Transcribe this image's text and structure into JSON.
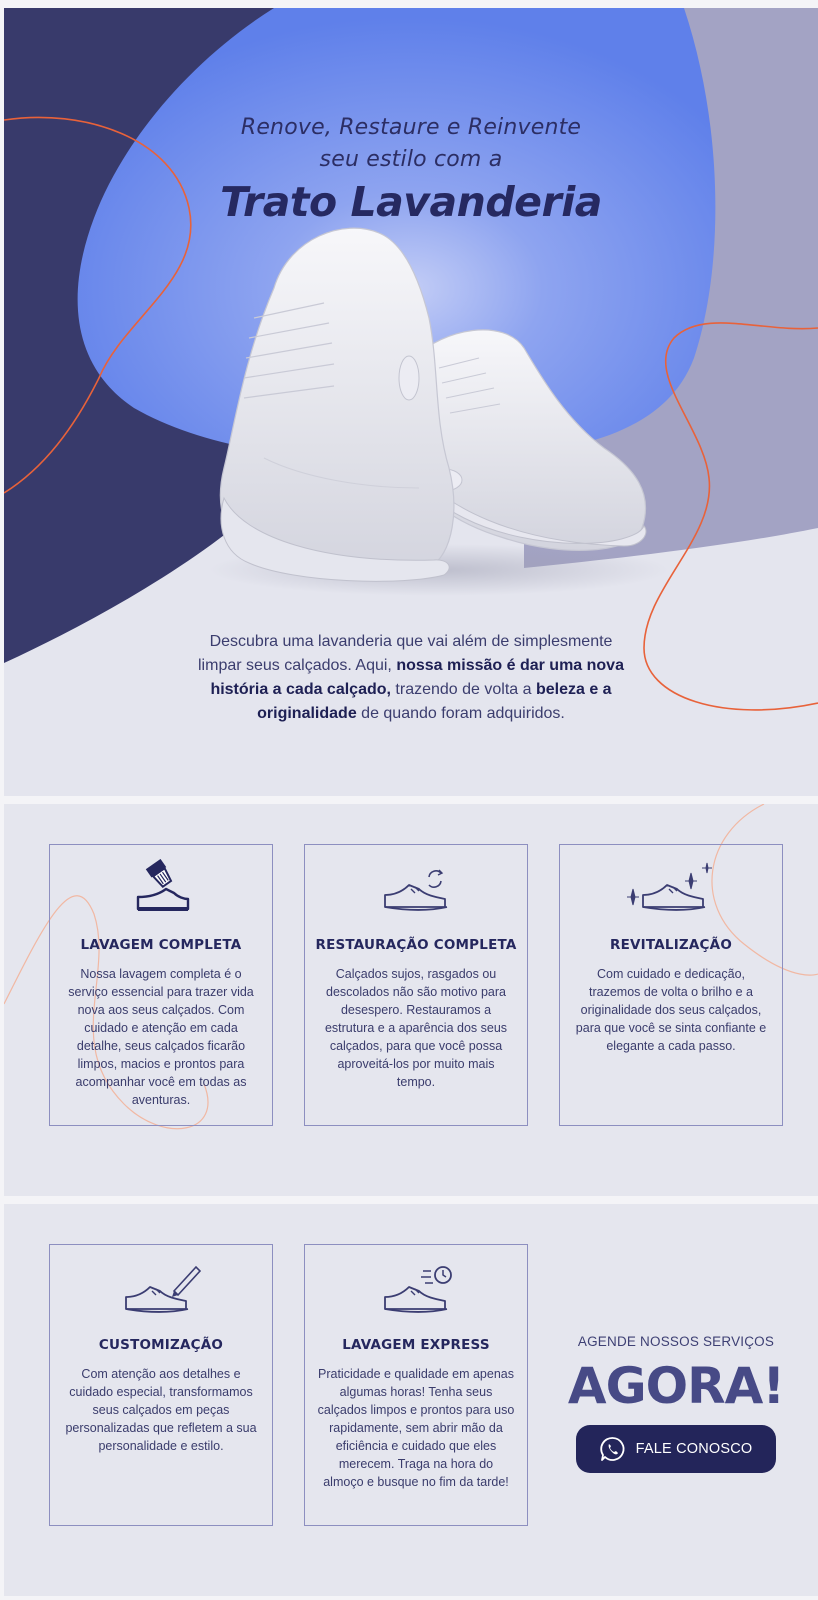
{
  "hero": {
    "line1": "Renove, Restaure e Reinvente",
    "line2": "seu estilo com a",
    "brand": "Trato Lavanderia",
    "description": {
      "p1": "Descubra uma lavanderia que vai além de simplesmente limpar seus calçados. Aqui, ",
      "b1": "nossa missão é dar uma nova história a cada calçado,",
      "p2": " trazendo de volta a ",
      "b2": "beleza e a originalidade",
      "p3": " de quando foram adquiridos."
    }
  },
  "services_row1": [
    {
      "icon": "brush-shoe-icon",
      "title": "LAVAGEM COMPLETA",
      "text": "Nossa lavagem completa é o serviço essencial para trazer vida nova aos seus calçados. Com cuidado e atenção em cada detalhe, seus calçados ficarão limpos, macios e prontos para acompanhar você em todas as aventuras."
    },
    {
      "icon": "sneaker-refresh-icon",
      "title": "RESTAURAÇÃO COMPLETA",
      "text": "Calçados sujos, rasgados ou descolados não são motivo para desespero. Restauramos a estrutura e a aparência dos seus calçados, para que você possa aproveitá-los por muito mais tempo."
    },
    {
      "icon": "sneaker-sparkle-icon",
      "title": "REVITALIZAÇÃO",
      "text": "Com cuidado e dedicação, trazemos de volta o brilho e a originalidade dos seus calçados, para que você se sinta confiante e elegante a cada passo."
    }
  ],
  "services_row2": [
    {
      "icon": "sneaker-pen-icon",
      "title": "CUSTOMIZAÇÃO",
      "text": "Com atenção aos detalhes e cuidado especial, transformamos seus calçados em peças personalizadas que refletem a sua personalidade e estilo."
    },
    {
      "icon": "sneaker-clock-icon",
      "title": "LAVAGEM EXPRESS",
      "text": "Praticidade e qualidade em apenas algumas horas! Tenha seus calçados limpos e prontos para uso rapidamente, sem abrir mão da eficiência e cuidado que eles merecem. Traga na hora do almoço e busque no fim da tarde!"
    }
  ],
  "cta": {
    "subtitle": "AGENDE NOSSOS SERVIÇOS",
    "headline": "AGORA!",
    "button_label": "FALE CONOSCO",
    "button_icon": "whatsapp-icon"
  },
  "colors": {
    "navy": "#383a6b",
    "blue_blob": "#6182ea",
    "lavender": "#a3a3c4",
    "orange_line": "#e8623a",
    "background": "#e4e5ee",
    "button": "#23255a"
  }
}
